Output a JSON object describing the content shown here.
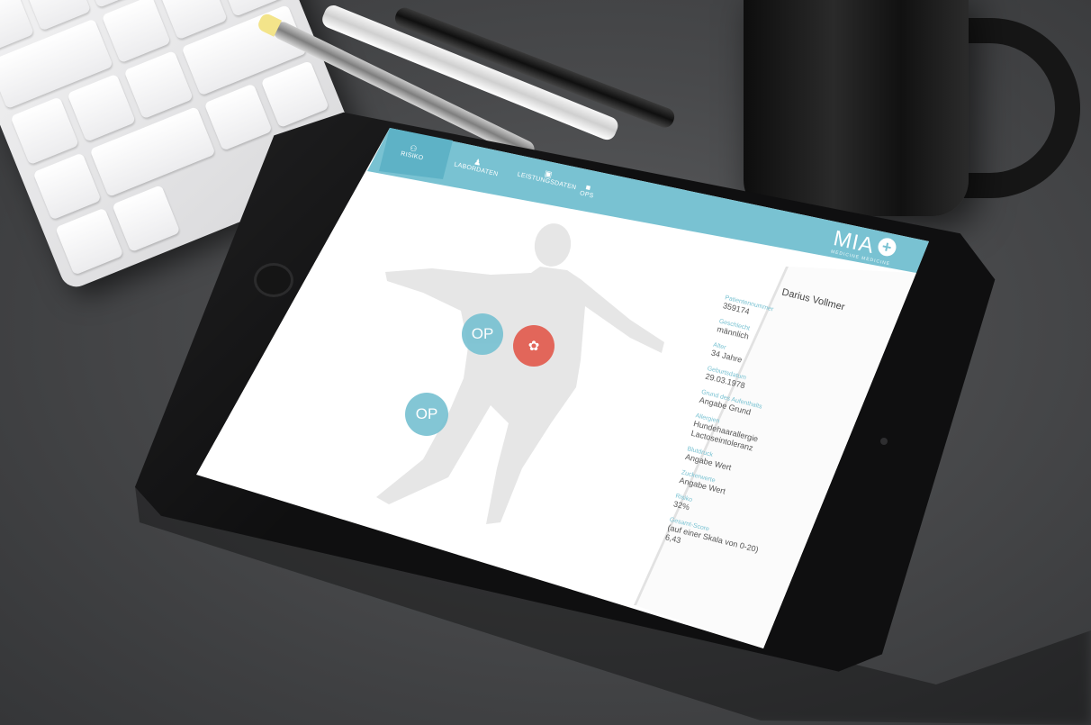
{
  "app": {
    "logo": {
      "name": "MIA",
      "subtitle": "MEDICINE MEDICINE"
    },
    "nav": [
      {
        "label": "RISIKO",
        "icon": "people-icon",
        "active": true
      },
      {
        "label": "LABORDATEN",
        "icon": "person-icon",
        "active": false
      },
      {
        "label": "LEISTUNGSDATEN",
        "icon": "folder-icon",
        "active": false
      },
      {
        "label": "OPS",
        "icon": "bag-icon",
        "active": false
      }
    ],
    "body_markers": [
      {
        "label": "OP",
        "color": "#79c2d2"
      },
      {
        "label": "OP",
        "color": "#79c2d2"
      },
      {
        "label": "",
        "icon": "kidney-icon",
        "color": "#e2665a"
      }
    ],
    "patient": {
      "name": "Darius Vollmer",
      "fields": [
        {
          "label": "Patientennummer",
          "value": "359174"
        },
        {
          "label": "Geschlecht",
          "value": "männlich"
        },
        {
          "label": "Alter",
          "value": "34 Jahre"
        },
        {
          "label": "Geburtsdatum",
          "value": "29.03.1978"
        },
        {
          "label": "Grund des Aufenthalts",
          "value": "Angabe Grund"
        },
        {
          "label": "Allergien",
          "value": "Hundehaarallergie\nLactoseintoleranz"
        },
        {
          "label": "Blutdruck",
          "value": "Angabe Wert"
        },
        {
          "label": "Zuckerwerte",
          "value": "Angabe Wert"
        },
        {
          "label": "Risiko",
          "value": "32%"
        },
        {
          "label": "Gesamt-Score",
          "value": "(auf einer Skala von 0-20)\n6,43"
        }
      ]
    },
    "colors": {
      "accent": "#79c2d2",
      "active_tab": "#5eb2c6",
      "kidney": "#e2665a",
      "body": "#e6e6e6"
    }
  }
}
